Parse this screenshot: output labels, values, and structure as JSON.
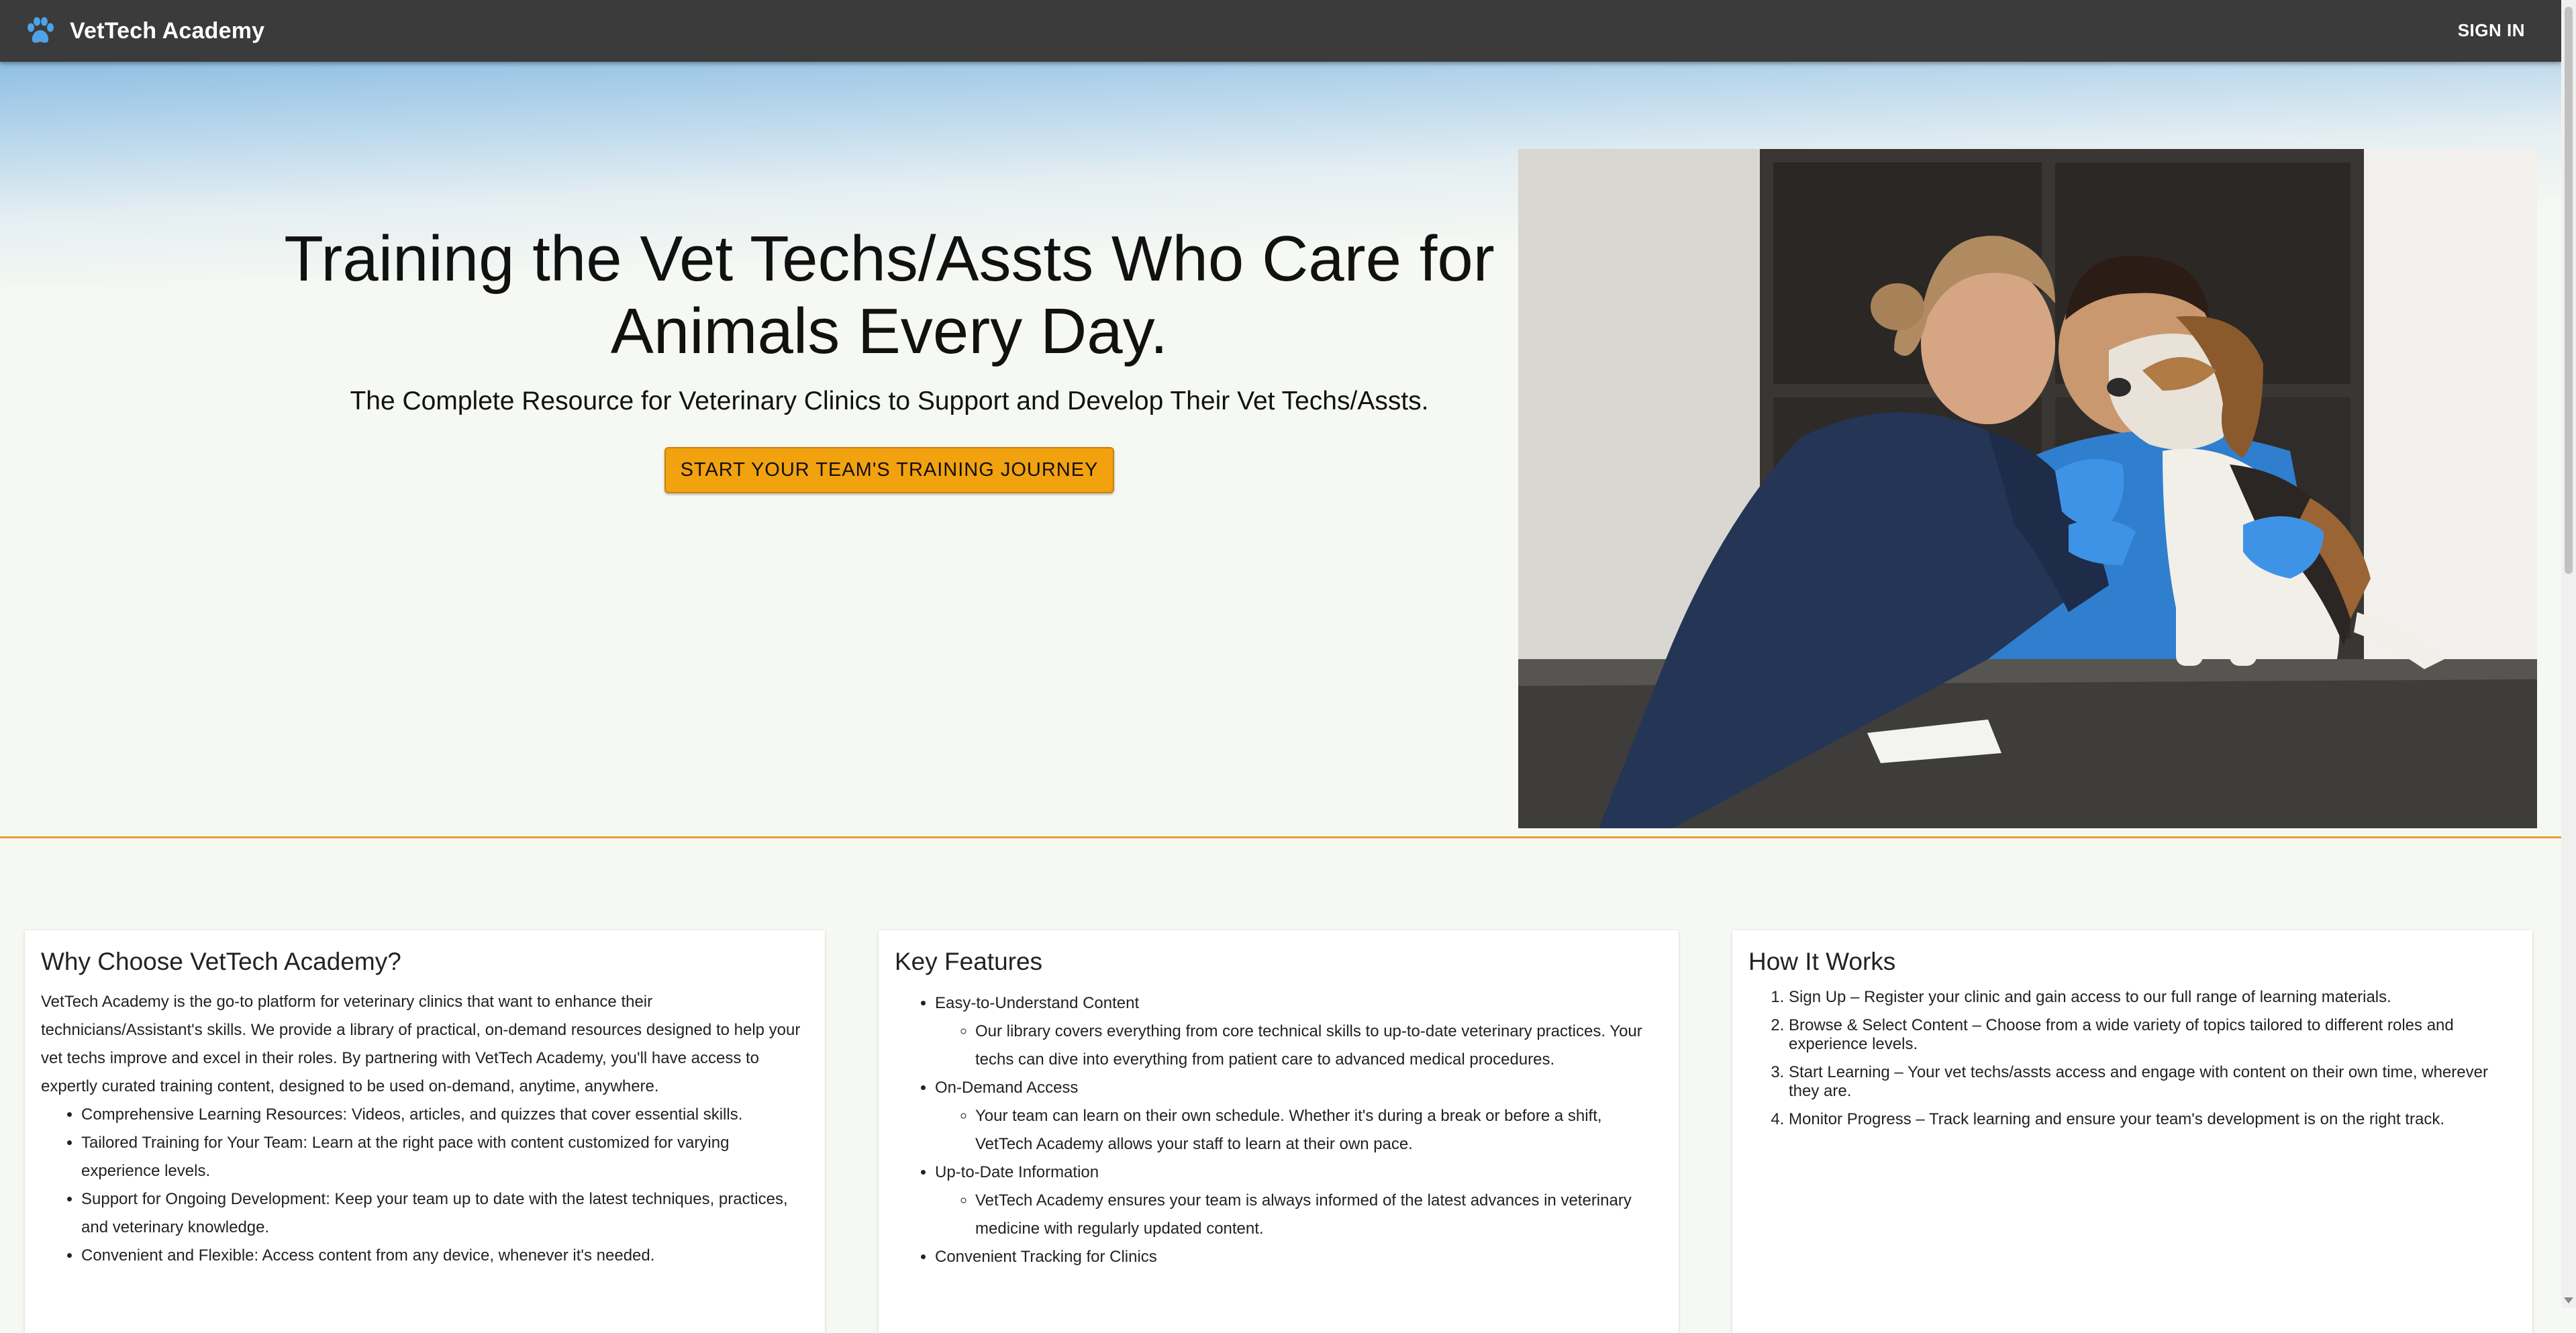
{
  "header": {
    "brand": "VetTech Academy",
    "sign_in": "SIGN IN"
  },
  "hero": {
    "title": "Training the Vet Techs/Assts Who Care for Animals Every Day.",
    "subtitle": "The Complete Resource for Veterinary Clinics to Support and Develop Their Vet Techs/Assts.",
    "cta": "START YOUR TEAM'S TRAINING JOURNEY"
  },
  "why": {
    "title": "Why Choose VetTech Academy?",
    "intro": "VetTech Academy is the go-to platform for veterinary clinics that want to enhance their technicians/Assistant's skills. We provide a library of practical, on-demand resources designed to help your vet techs improve and excel in their roles. By partnering with VetTech Academy, you'll have access to expertly curated training content, designed to be used on-demand, anytime, anywhere.",
    "items": [
      "Comprehensive Learning Resources: Videos, articles, and quizzes that cover essential skills.",
      "Tailored Training for Your Team: Learn at the right pace with content customized for varying experience levels.",
      "Support for Ongoing Development: Keep your team up to date with the latest techniques, practices, and veterinary knowledge.",
      "Convenient and Flexible: Access content from any device, whenever it's needed."
    ]
  },
  "features": {
    "title": "Key Features",
    "items": [
      {
        "label": "Easy-to-Understand Content",
        "detail": "Our library covers everything from core technical skills to up-to-date veterinary practices. Your techs can dive into everything from patient care to advanced medical procedures."
      },
      {
        "label": "On-Demand Access",
        "detail": "Your team can learn on their own schedule. Whether it's during a break or before a shift, VetTech Academy allows your staff to learn at their own pace."
      },
      {
        "label": "Up-to-Date Information",
        "detail": "VetTech Academy ensures your team is always informed of the latest advances in veterinary medicine with regularly updated content."
      },
      {
        "label": "Convenient Tracking for Clinics"
      }
    ]
  },
  "how": {
    "title": "How It Works",
    "steps": [
      "Sign Up – Register your clinic and gain access to our full range of learning materials.",
      "Browse & Select Content – Choose from a wide variety of topics tailored to different roles and experience levels.",
      "Start Learning – Your vet techs/assts access and engage with content on their own time, wherever they are.",
      "Monitor Progress – Track learning and ensure your team's development is on the right track."
    ]
  },
  "colors": {
    "appbar": "#3b3b3b",
    "accent": "#f2a10f",
    "brand_icon": "#4ea3e8",
    "divider": "#e3a32b"
  },
  "icons": {
    "brand": "paw-icon"
  }
}
